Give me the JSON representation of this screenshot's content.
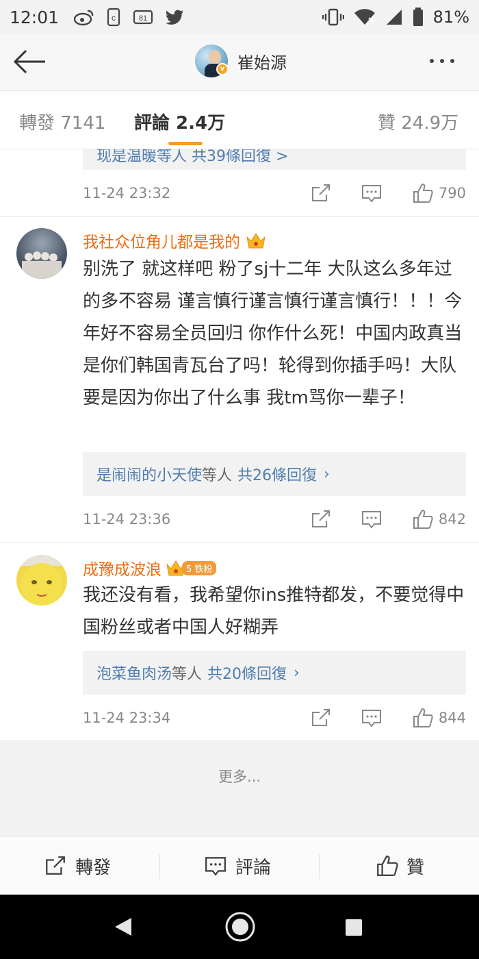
{
  "status_bar": {
    "time": "12:01",
    "battery": "81%",
    "left_icons": [
      "weibo-icon",
      "c-box-icon",
      "81-box-icon",
      "twitter-icon"
    ],
    "right_icons": [
      "vibrate-icon",
      "wifi-icon",
      "signal-icon",
      "battery-icon"
    ]
  },
  "header": {
    "title": "崔始源"
  },
  "tabs": [
    {
      "label": "轉發 7141"
    },
    {
      "label": "評論 2.4万"
    },
    {
      "label": "贊 24.9万"
    }
  ],
  "accent_color": "#f79b25",
  "username_color": "#ee6d12",
  "link_color": "#507daf",
  "top_partial": {
    "reply_text": "现是温暖等人 共39條回復 >",
    "time": "11-24 23:32",
    "likes": "790"
  },
  "comments": [
    {
      "username": "我社众位角儿都是我的",
      "text": "别洗了 就这样吧 粉了sj十二年 大队这么多年过的多不容易 谨言慎行谨言慎行谨言慎行！！！今年好不容易全员回归 你作什么死！中国内政真当是你们韩国青瓦台了吗！轮得到你插手吗！大队要是因为你出了什么事 我tm骂你一辈子！",
      "reply_names": "是闹闹的小天使",
      "reply_mid": "等人",
      "reply_count": "共26條回復",
      "time": "11-24 23:36",
      "likes": "842"
    },
    {
      "username": "成豫成波浪",
      "badge_level": "5",
      "fan_badge": "铁粉",
      "text": "我还没有看，我希望你ins推特都发，不要觉得中国粉丝或者中国人好糊弄",
      "reply_names": "泡菜鱼肉汤",
      "reply_mid": "等人",
      "reply_count": "共20條回復",
      "time": "11-24 23:34",
      "likes": "844"
    }
  ],
  "more_label": "更多...",
  "action_bar": {
    "repost": "轉發",
    "comment": "評論",
    "like": "贊"
  }
}
